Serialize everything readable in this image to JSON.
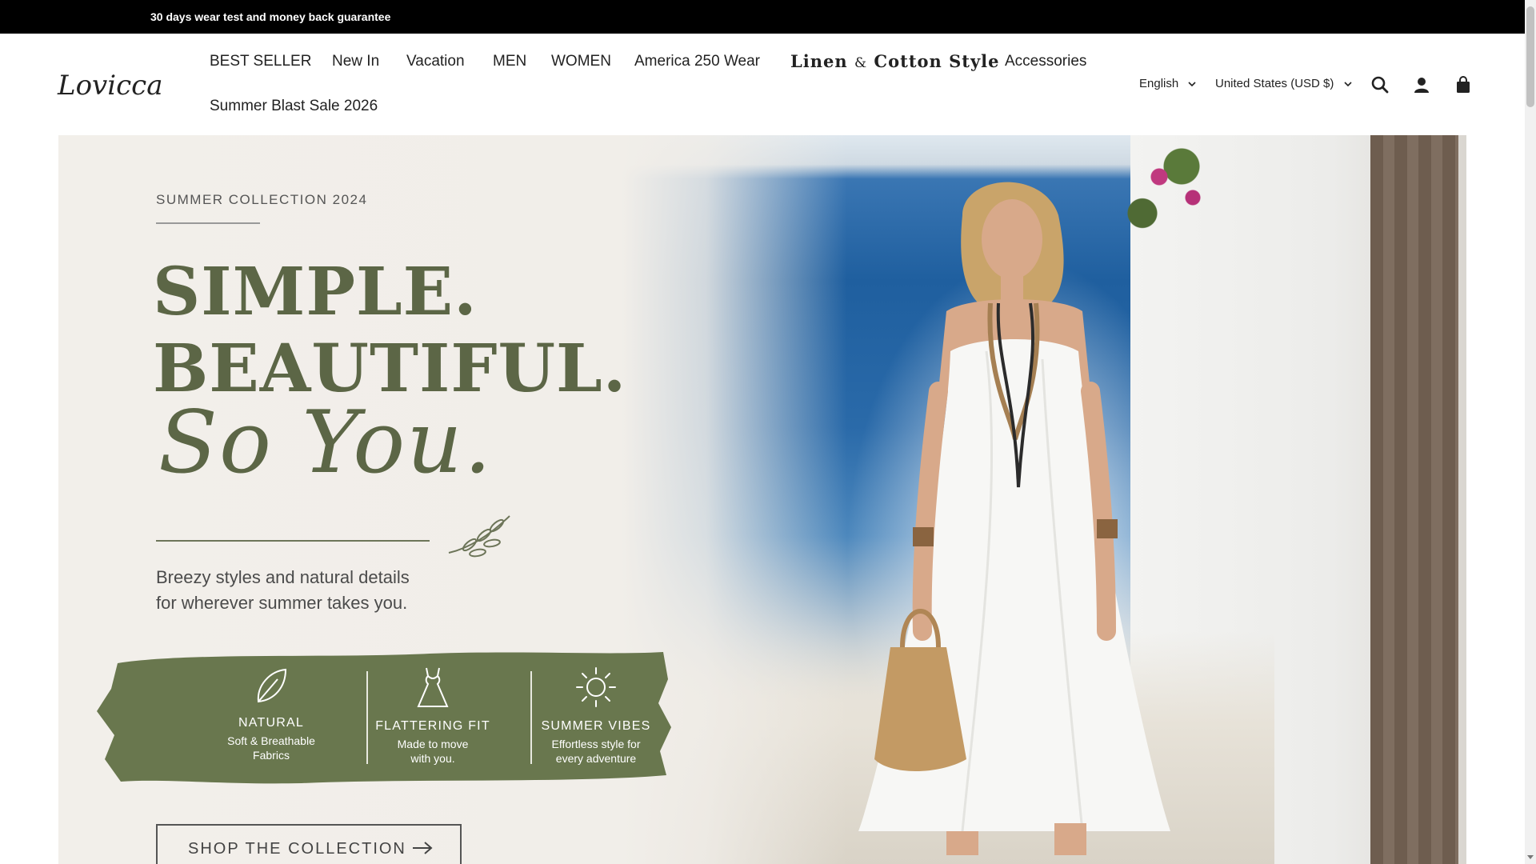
{
  "announcement": {
    "text": "30 days wear test and money back guarantee"
  },
  "header": {
    "logo_text": "Lovicca",
    "nav": [
      {
        "label": "BEST SELLER"
      },
      {
        "label": "New In"
      },
      {
        "label": "Vacation"
      },
      {
        "label": "MEN"
      },
      {
        "label": "WOMEN"
      },
      {
        "label": "America 250 Wear"
      },
      {
        "label_a": "Linen",
        "label_amp": "&",
        "label_b": "Cotton Style"
      },
      {
        "label": "Accessories"
      },
      {
        "label": "Summer Blast Sale 2026"
      }
    ],
    "language": "English",
    "currency": "United States (USD $)",
    "icons": [
      "search-icon",
      "account-icon",
      "cart-icon"
    ]
  },
  "hero": {
    "eyebrow": "SUMMER COLLECTION 2024",
    "headline_1": "SIMPLE.",
    "headline_2": "BEAUTIFUL.",
    "script": "So You.",
    "sub_1": "Breezy styles and natural details",
    "sub_2": "for wherever summer takes you.",
    "features": [
      {
        "icon": "leaf-icon",
        "title": "NATURAL",
        "desc_1": "Soft & Breathable",
        "desc_2": "Fabrics"
      },
      {
        "icon": "dress-icon",
        "title": "FLATTERING FIT",
        "desc_1": "Made to move",
        "desc_2": "with you."
      },
      {
        "icon": "sun-icon",
        "title": "SUMMER VIBES",
        "desc_1": "Effortless style for",
        "desc_2": "every adventure"
      }
    ],
    "cta": "SHOP THE COLLECTION"
  },
  "colors": {
    "accent_olive": "#5c6646",
    "band_olive": "#69774e",
    "announcement_bg": "#000000"
  }
}
